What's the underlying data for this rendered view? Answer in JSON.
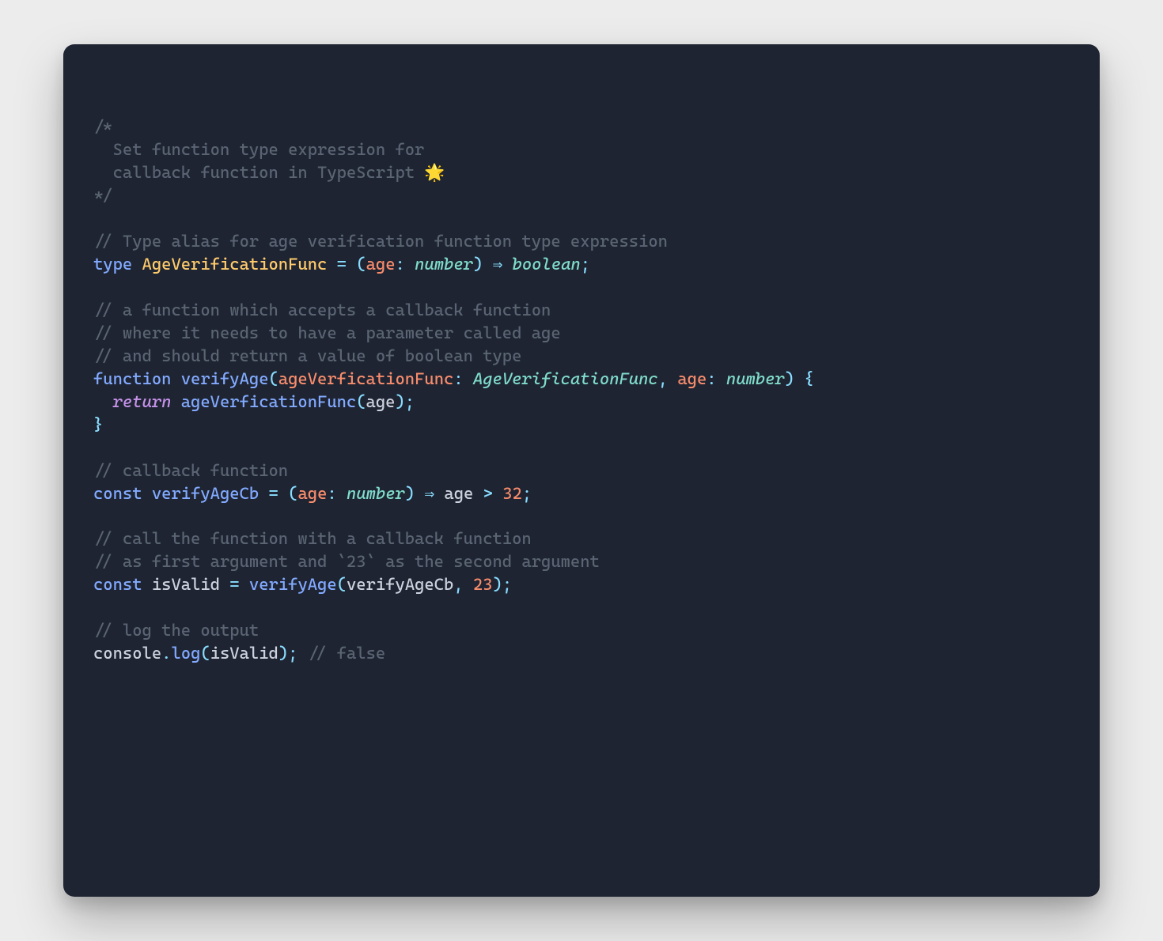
{
  "colors": {
    "background_page": "#ececec",
    "background_card": "#1e2432",
    "comment": "#5a6472",
    "keyword": "#c792ea",
    "type_builtin": "#82aaff",
    "type_name": "#ffcb6b",
    "type_annotation": "#7fdbca",
    "param": "#f78c6c",
    "number": "#f78c6c",
    "funcname": "#82aaff",
    "ident": "#cdd3de",
    "punct": "#89ddff"
  },
  "code": {
    "lines": [
      [
        {
          "cls": "tok-comment",
          "text": "/*"
        }
      ],
      [
        {
          "cls": "tok-comment",
          "text": "  Set function type expression for"
        }
      ],
      [
        {
          "cls": "tok-comment",
          "text": "  callback function in TypeScript 🌟"
        }
      ],
      [
        {
          "cls": "tok-comment",
          "text": "*/"
        }
      ],
      [],
      [
        {
          "cls": "tok-comment",
          "text": "// Type alias for age verification function type expression"
        }
      ],
      [
        {
          "cls": "tok-type",
          "text": "type"
        },
        {
          "cls": "tok-default",
          "text": " "
        },
        {
          "cls": "tok-typename",
          "text": "AgeVerificationFunc"
        },
        {
          "cls": "tok-default",
          "text": " "
        },
        {
          "cls": "tok-punct",
          "text": "="
        },
        {
          "cls": "tok-default",
          "text": " "
        },
        {
          "cls": "tok-punct",
          "text": "("
        },
        {
          "cls": "tok-param",
          "text": "age"
        },
        {
          "cls": "tok-punct",
          "text": ":"
        },
        {
          "cls": "tok-default",
          "text": " "
        },
        {
          "cls": "tok-paramtype",
          "text": "number"
        },
        {
          "cls": "tok-punct",
          "text": ")"
        },
        {
          "cls": "tok-default",
          "text": " "
        },
        {
          "cls": "tok-punct",
          "text": "⇒"
        },
        {
          "cls": "tok-default",
          "text": " "
        },
        {
          "cls": "tok-paramtype",
          "text": "boolean"
        },
        {
          "cls": "tok-punct",
          "text": ";"
        }
      ],
      [],
      [
        {
          "cls": "tok-comment",
          "text": "// a function which accepts a callback function"
        }
      ],
      [
        {
          "cls": "tok-comment",
          "text": "// where it needs to have a parameter called age"
        }
      ],
      [
        {
          "cls": "tok-comment",
          "text": "// and should return a value of boolean type"
        }
      ],
      [
        {
          "cls": "tok-type",
          "text": "function"
        },
        {
          "cls": "tok-default",
          "text": " "
        },
        {
          "cls": "tok-funcdef",
          "text": "verifyAge"
        },
        {
          "cls": "tok-punct",
          "text": "("
        },
        {
          "cls": "tok-param",
          "text": "ageVerficationFunc"
        },
        {
          "cls": "tok-punct",
          "text": ":"
        },
        {
          "cls": "tok-default",
          "text": " "
        },
        {
          "cls": "tok-paramtype",
          "text": "AgeVerificationFunc"
        },
        {
          "cls": "tok-punct",
          "text": ","
        },
        {
          "cls": "tok-default",
          "text": " "
        },
        {
          "cls": "tok-param",
          "text": "age"
        },
        {
          "cls": "tok-punct",
          "text": ":"
        },
        {
          "cls": "tok-default",
          "text": " "
        },
        {
          "cls": "tok-paramtype",
          "text": "number"
        },
        {
          "cls": "tok-punct",
          "text": ")"
        },
        {
          "cls": "tok-default",
          "text": " "
        },
        {
          "cls": "tok-punct",
          "text": "{"
        }
      ],
      [
        {
          "cls": "tok-default",
          "text": "  "
        },
        {
          "cls": "tok-keyword-it",
          "text": "return"
        },
        {
          "cls": "tok-default",
          "text": " "
        },
        {
          "cls": "tok-funccall",
          "text": "ageVerficationFunc"
        },
        {
          "cls": "tok-punct",
          "text": "("
        },
        {
          "cls": "tok-ident",
          "text": "age"
        },
        {
          "cls": "tok-punct",
          "text": ");"
        }
      ],
      [
        {
          "cls": "tok-punct",
          "text": "}"
        }
      ],
      [],
      [
        {
          "cls": "tok-comment",
          "text": "// callback function"
        }
      ],
      [
        {
          "cls": "tok-type",
          "text": "const"
        },
        {
          "cls": "tok-default",
          "text": " "
        },
        {
          "cls": "tok-funcdef",
          "text": "verifyAgeCb"
        },
        {
          "cls": "tok-default",
          "text": " "
        },
        {
          "cls": "tok-punct",
          "text": "="
        },
        {
          "cls": "tok-default",
          "text": " "
        },
        {
          "cls": "tok-punct",
          "text": "("
        },
        {
          "cls": "tok-param",
          "text": "age"
        },
        {
          "cls": "tok-punct",
          "text": ":"
        },
        {
          "cls": "tok-default",
          "text": " "
        },
        {
          "cls": "tok-paramtype",
          "text": "number"
        },
        {
          "cls": "tok-punct",
          "text": ")"
        },
        {
          "cls": "tok-default",
          "text": " "
        },
        {
          "cls": "tok-punct",
          "text": "⇒"
        },
        {
          "cls": "tok-default",
          "text": " "
        },
        {
          "cls": "tok-ident",
          "text": "age"
        },
        {
          "cls": "tok-default",
          "text": " "
        },
        {
          "cls": "tok-punct",
          "text": ">"
        },
        {
          "cls": "tok-default",
          "text": " "
        },
        {
          "cls": "tok-number",
          "text": "32"
        },
        {
          "cls": "tok-punct",
          "text": ";"
        }
      ],
      [],
      [
        {
          "cls": "tok-comment",
          "text": "// call the function with a callback function"
        }
      ],
      [
        {
          "cls": "tok-comment",
          "text": "// as first argument and `23` as the second argument"
        }
      ],
      [
        {
          "cls": "tok-type",
          "text": "const"
        },
        {
          "cls": "tok-default",
          "text": " "
        },
        {
          "cls": "tok-ident",
          "text": "isValid"
        },
        {
          "cls": "tok-default",
          "text": " "
        },
        {
          "cls": "tok-punct",
          "text": "="
        },
        {
          "cls": "tok-default",
          "text": " "
        },
        {
          "cls": "tok-funccall",
          "text": "verifyAge"
        },
        {
          "cls": "tok-punct",
          "text": "("
        },
        {
          "cls": "tok-ident",
          "text": "verifyAgeCb"
        },
        {
          "cls": "tok-punct",
          "text": ","
        },
        {
          "cls": "tok-default",
          "text": " "
        },
        {
          "cls": "tok-number",
          "text": "23"
        },
        {
          "cls": "tok-punct",
          "text": ");"
        }
      ],
      [],
      [
        {
          "cls": "tok-comment",
          "text": "// log the output"
        }
      ],
      [
        {
          "cls": "tok-ident",
          "text": "console"
        },
        {
          "cls": "tok-punct",
          "text": "."
        },
        {
          "cls": "tok-funccall",
          "text": "log"
        },
        {
          "cls": "tok-punct",
          "text": "("
        },
        {
          "cls": "tok-ident",
          "text": "isValid"
        },
        {
          "cls": "tok-punct",
          "text": ");"
        },
        {
          "cls": "tok-default",
          "text": " "
        },
        {
          "cls": "tok-comment",
          "text": "// false"
        }
      ]
    ]
  }
}
